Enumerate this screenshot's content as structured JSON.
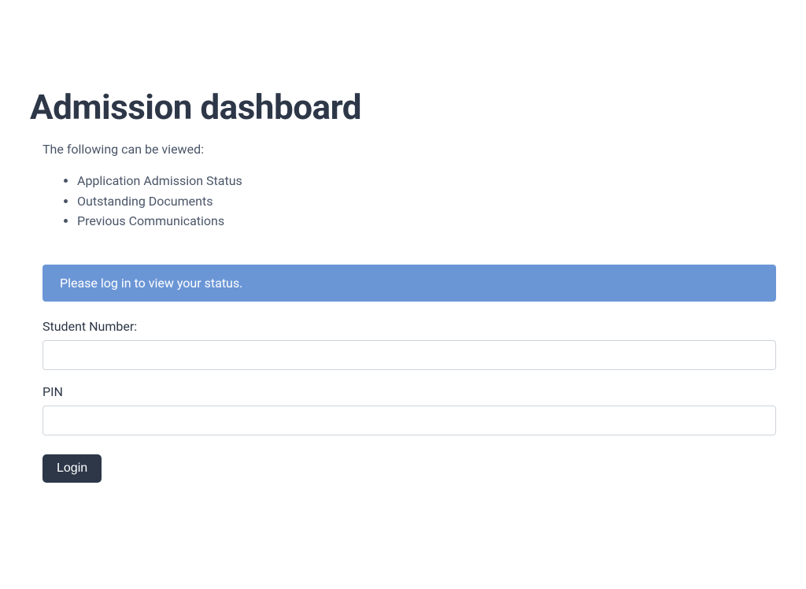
{
  "heading": "Admission dashboard",
  "intro": "The following can be viewed:",
  "list_items": [
    "Application Admission Status",
    "Outstanding Documents",
    "Previous Communications"
  ],
  "alert_message": "Please log in to view your status.",
  "form": {
    "student_number_label": "Student Number:",
    "student_number_value": "",
    "pin_label": "PIN",
    "pin_value": "",
    "login_button_label": "Login"
  }
}
